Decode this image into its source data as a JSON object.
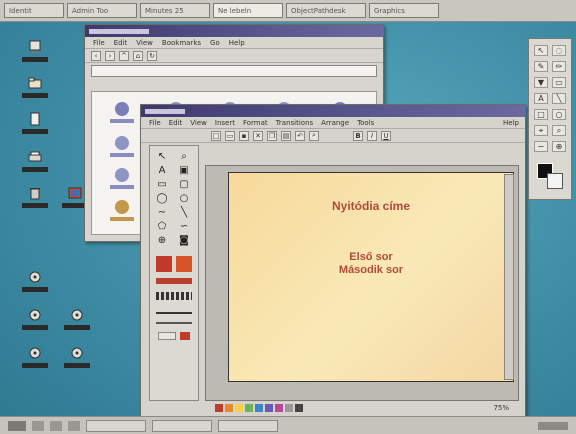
{
  "taskbar_top": {
    "tabs": [
      {
        "label": "Identit"
      },
      {
        "label": "Admin Too"
      },
      {
        "label": "Minutes 25"
      },
      {
        "label": "Ne lebeln"
      },
      {
        "label": "ObjectPathdesk"
      },
      {
        "label": "Graphics"
      }
    ]
  },
  "file_manager": {
    "menu": [
      "File",
      "Edit",
      "View",
      "Bookmarks",
      "Go",
      "Help"
    ]
  },
  "presentation": {
    "menu": [
      "File",
      "Edit",
      "View",
      "Insert",
      "Format",
      "Transitions",
      "Arrange",
      "Tools"
    ],
    "help": "Help",
    "slide": {
      "title": "Nyitódia címe",
      "lines": [
        "Első sor",
        "Második sor"
      ]
    },
    "zoom": "75%",
    "status_colors": [
      "#c23a2a",
      "#e38a2e",
      "#f2d24a",
      "#6fb25a",
      "#3a86c8",
      "#6a58b6",
      "#b54a9a",
      "#9a9a9a",
      "#444444"
    ]
  },
  "desktop": {
    "accent": "#3e8da5"
  }
}
